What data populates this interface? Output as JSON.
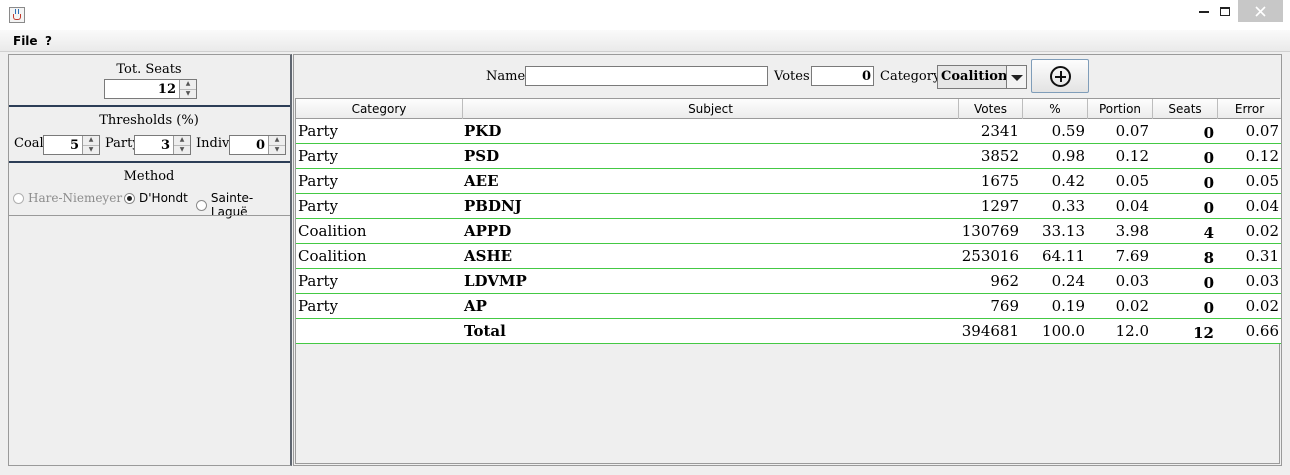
{
  "window": {
    "icon": "java-cup-icon"
  },
  "menu": {
    "file": "File",
    "help": "?"
  },
  "left": {
    "tot_seats": {
      "title": "Tot. Seats",
      "value": "12"
    },
    "thresholds": {
      "title": "Thresholds (%)",
      "coal_label": "Coal.",
      "coal_value": "5",
      "party_label": "Party",
      "party_value": "3",
      "indiv_label": "Indiv.",
      "indiv_value": "0"
    },
    "method": {
      "title": "Method",
      "options": [
        "Hare-Niemeyer",
        "D'Hondt",
        "Sainte-Laguë"
      ],
      "selected": "D'Hondt"
    }
  },
  "form": {
    "name_label": "Name",
    "name_value": "",
    "votes_label": "Votes",
    "votes_value": "0",
    "category_label": "Category",
    "category_value": "Coalition",
    "add_icon": "plus-circle-icon"
  },
  "table": {
    "columns": [
      "Category",
      "Subject",
      "Votes",
      "%",
      "Portion",
      "Seats",
      "Error"
    ],
    "rows": [
      [
        "Party",
        "PKD",
        "2341",
        "0.59",
        "0.07",
        "0",
        "0.07"
      ],
      [
        "Party",
        "PSD",
        "3852",
        "0.98",
        "0.12",
        "0",
        "0.12"
      ],
      [
        "Party",
        "AEE",
        "1675",
        "0.42",
        "0.05",
        "0",
        "0.05"
      ],
      [
        "Party",
        "PBDNJ",
        "1297",
        "0.33",
        "0.04",
        "0",
        "0.04"
      ],
      [
        "Coalition",
        "APPD",
        "130769",
        "33.13",
        "3.98",
        "4",
        "0.02"
      ],
      [
        "Coalition",
        "ASHE",
        "253016",
        "64.11",
        "7.69",
        "8",
        "0.31"
      ],
      [
        "Party",
        "LDVMP",
        "962",
        "0.24",
        "0.03",
        "0",
        "0.03"
      ],
      [
        "Party",
        "AP",
        "769",
        "0.19",
        "0.02",
        "0",
        "0.02"
      ],
      [
        "",
        "Total",
        "394681",
        "100.0",
        "12.0",
        "12",
        "0.66"
      ]
    ]
  }
}
